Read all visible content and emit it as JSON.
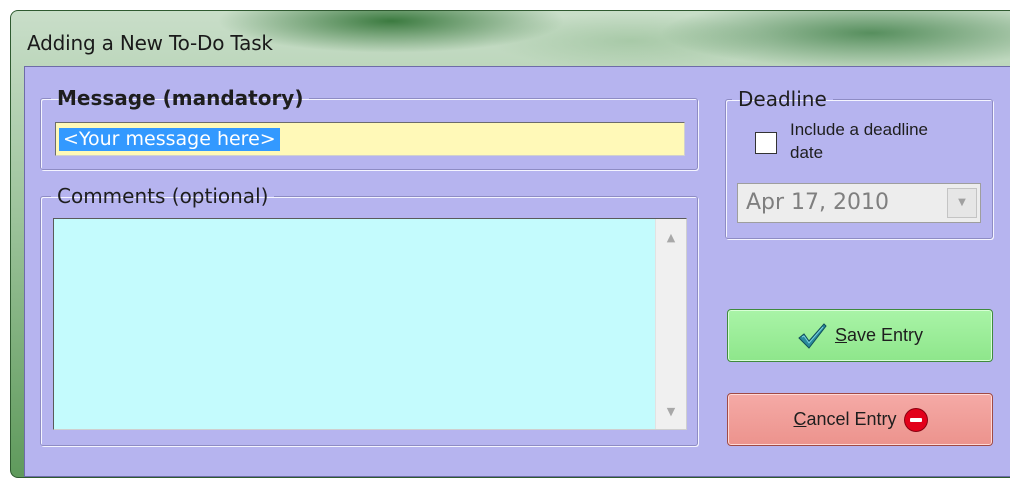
{
  "window": {
    "title": "Adding a New To-Do Task"
  },
  "message": {
    "group_label": "Message (mandatory)",
    "value": "<Your message here>"
  },
  "comments": {
    "group_label": "Comments (optional)",
    "value": ""
  },
  "deadline": {
    "group_label": "Deadline",
    "checkbox_label": "Include a deadline date",
    "checked": false,
    "date_value": "Apr 17, 2010"
  },
  "buttons": {
    "save_label": "Save Entry",
    "cancel_label": "Cancel Entry"
  },
  "colors": {
    "client_background": "#b6b4ef",
    "message_field": "#fff9b8",
    "comments_field": "#c4fbfd",
    "save_button": "#98ec95",
    "cancel_button": "#f0a09b",
    "selection": "#3399ff"
  },
  "icons": {
    "save": "checkmark-icon",
    "cancel": "stop-icon"
  }
}
